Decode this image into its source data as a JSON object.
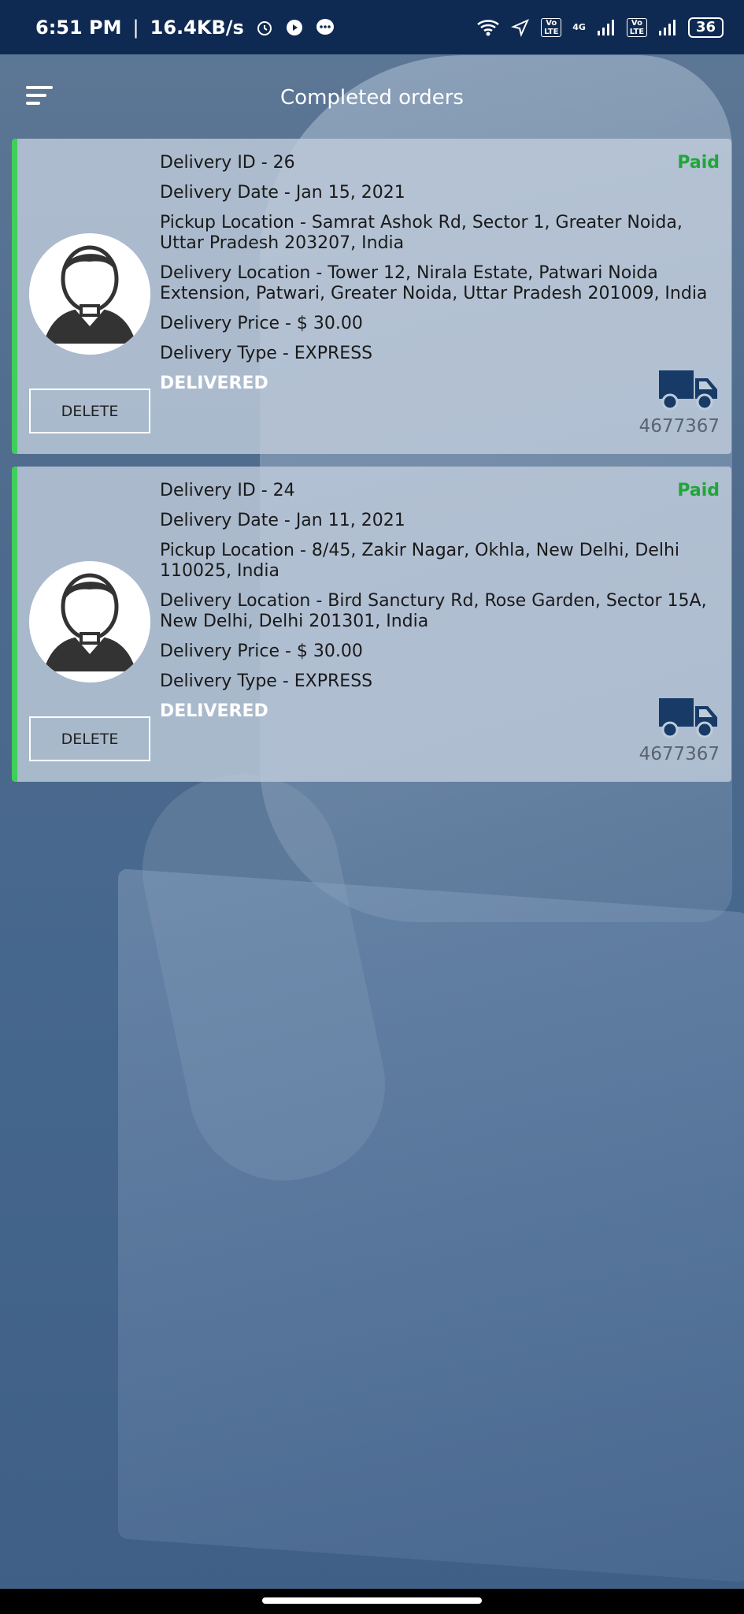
{
  "status_bar": {
    "time": "6:51 PM",
    "speed": "16.4KB/s",
    "network": "4G",
    "volte1": "Vo LTE",
    "volte2": "Vo LTE",
    "battery": "36"
  },
  "header": {
    "title": "Completed orders",
    "menu_icon": "menu-icon"
  },
  "orders": [
    {
      "delivery_id": "Delivery ID - 26",
      "delivery_date": "Delivery Date - Jan 15, 2021",
      "pickup": "Pickup Location - Samrat Ashok Rd, Sector 1, Greater Noida, Uttar Pradesh 203207, India",
      "delivery_location": "Delivery Location - Tower 12, Nirala Estate, Patwari Noida Extension, Patwari, Greater Noida, Uttar Pradesh 201009, India",
      "price": "Delivery Price - $ 30.00",
      "type": "Delivery Type - EXPRESS",
      "status": "DELIVERED",
      "payment": "Paid",
      "tracking": "4677367",
      "delete_label": "DELETE"
    },
    {
      "delivery_id": "Delivery ID - 24",
      "delivery_date": "Delivery Date - Jan 11, 2021",
      "pickup": "Pickup Location - 8/45, Zakir Nagar, Okhla, New Delhi, Delhi 110025, India",
      "delivery_location": "Delivery Location - Bird Sanctury Rd, Rose Garden, Sector 15A, New Delhi, Delhi 201301, India",
      "price": "Delivery Price - $ 30.00",
      "type": "Delivery Type - EXPRESS",
      "status": "DELIVERED",
      "payment": "Paid",
      "tracking": "4677367",
      "delete_label": "DELETE"
    }
  ],
  "colors": {
    "status_bar": "#0f2a52",
    "accent_border": "#3fcf5a",
    "paid": "#1fa637",
    "truck": "#173a67"
  }
}
